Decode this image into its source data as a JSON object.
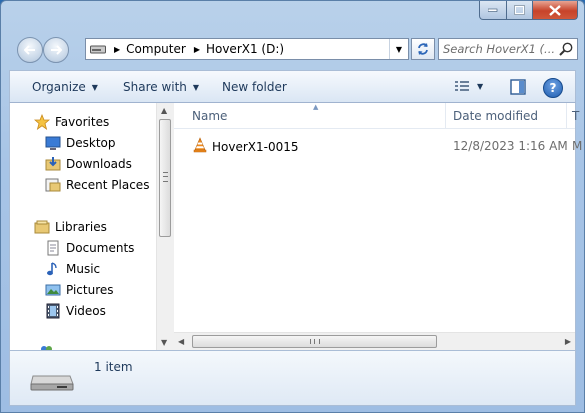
{
  "address": {
    "crumbs": [
      "Computer",
      "HoverX1 (D:)"
    ]
  },
  "search": {
    "placeholder": "Search HoverX1 (..."
  },
  "toolbar": {
    "organize": "Organize",
    "share_with": "Share with",
    "new_folder": "New folder"
  },
  "sidebar": {
    "favorites": {
      "label": "Favorites",
      "items": [
        "Desktop",
        "Downloads",
        "Recent Places"
      ]
    },
    "libraries": {
      "label": "Libraries",
      "items": [
        "Documents",
        "Music",
        "Pictures",
        "Videos"
      ]
    }
  },
  "file_list": {
    "columns": {
      "name": "Name",
      "date": "Date modified",
      "truncated": "T"
    },
    "rows": [
      {
        "name": "HoverX1-0015",
        "date": "12/8/2023 1:16 AM",
        "truncated": "M"
      }
    ]
  },
  "details": {
    "item_count": "1 item"
  },
  "colors": {
    "titlebar": "#a7c4e6",
    "close": "#c7432a",
    "accent": "#1e395b"
  }
}
